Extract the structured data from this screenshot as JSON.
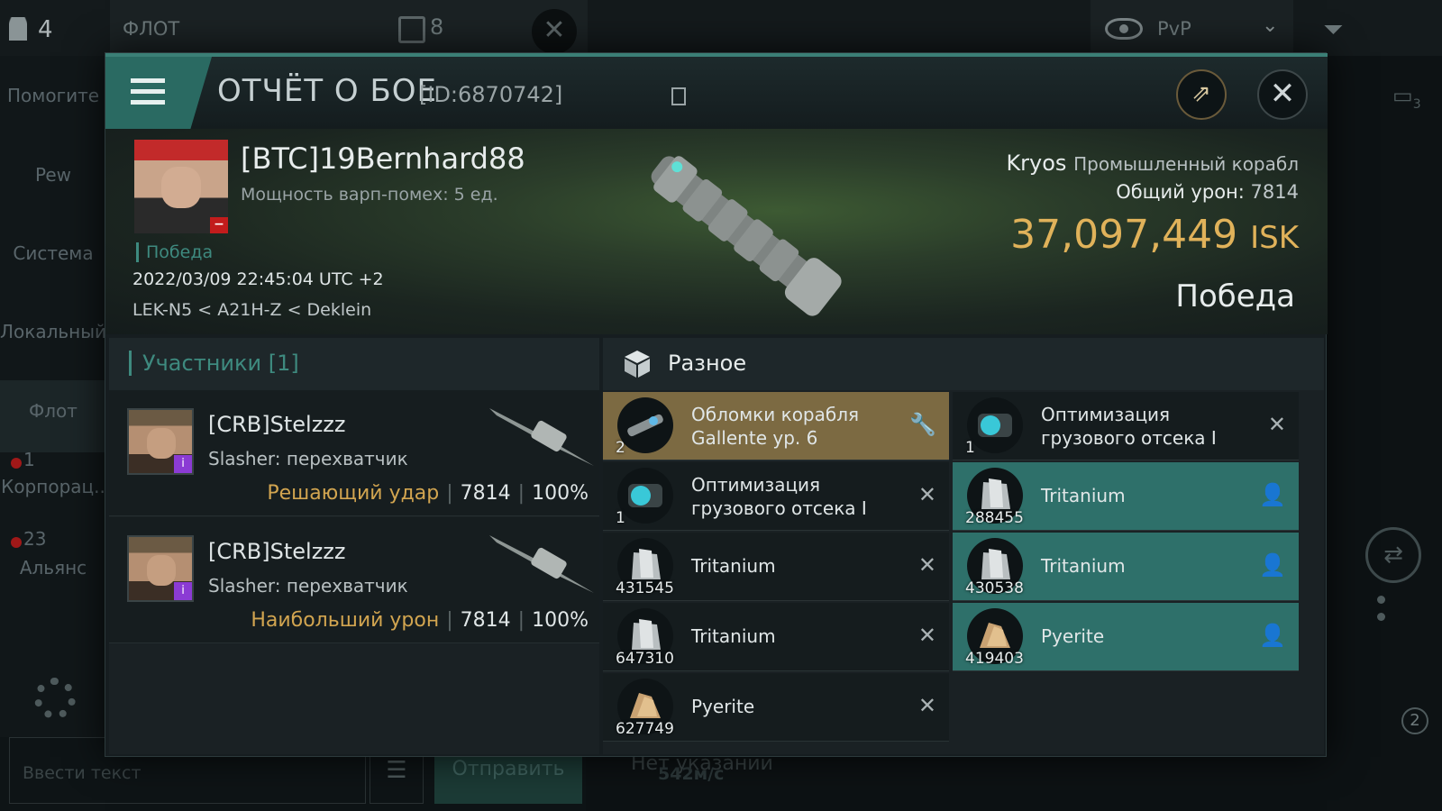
{
  "background": {
    "players_count": "4",
    "fleet_title": "ФЛОТ",
    "fleet_count": "8",
    "pvp_label": "PvP",
    "sidebar": [
      {
        "label": "Помогите"
      },
      {
        "label": "Pew"
      },
      {
        "label": "Система"
      },
      {
        "label": "Локальный"
      },
      {
        "label": "Флот"
      },
      {
        "label": "Корпорац.."
      },
      {
        "label": "Альянс"
      }
    ],
    "corp_badge": "1",
    "alliance_badge": "23",
    "chat_placeholder": "Ввести текст",
    "send_label": "Отправить",
    "bottom_hint": "Нет указаний",
    "speed": "542м/с",
    "right_badge": "2",
    "chat_count": "3"
  },
  "report": {
    "title": "ОТЧЁТ О БОЕ",
    "id": "[ID:6870742]",
    "pilot": "[BTC]19Bernhard88",
    "warp": "Мощность варп-помех: 5 ед.",
    "victory_tag": "Победа",
    "datetime": "2022/03/09 22:45:04 UTC +2",
    "location": "LEK-N5 < A21H-Z < Deklein",
    "ship_name": "Kryos",
    "ship_class": "Промышленный корабл",
    "damage_label": "Общий урон:",
    "damage_value": "7814",
    "isk_value": "37,097,449",
    "isk_unit": "ISK",
    "result": "Победа"
  },
  "participants": {
    "header": "Участники [1]",
    "rows": [
      {
        "name": "[CRB]Stelzzz",
        "ship": "Slasher: перехватчик",
        "role": "Решающий удар",
        "damage": "7814",
        "pct": "100%"
      },
      {
        "name": "[CRB]Stelzzz",
        "ship": "Slasher: перехватчик",
        "role": "Наибольший урон",
        "damage": "7814",
        "pct": "100%"
      }
    ]
  },
  "loot": {
    "header": "Разное",
    "items": [
      {
        "name": "Обломки корабля Gallente ур. 6",
        "qty": "2",
        "state": "highlight",
        "action": "wrench-icon"
      },
      {
        "name": "Оптимизация грузового отсека I",
        "qty": "1",
        "state": "dropped",
        "action": "close-icon"
      },
      {
        "name": "Оптимизация грузового отсека I",
        "qty": "1",
        "state": "dropped",
        "action": "close-icon"
      },
      {
        "name": "Tritanium",
        "qty": "288455",
        "state": "owned",
        "action": "person-icon"
      },
      {
        "name": "Tritanium",
        "qty": "431545",
        "state": "dropped",
        "action": "close-icon"
      },
      {
        "name": "Tritanium",
        "qty": "430538",
        "state": "owned",
        "action": "person-icon"
      },
      {
        "name": "Tritanium",
        "qty": "647310",
        "state": "dropped",
        "action": "close-icon"
      },
      {
        "name": "Pyerite",
        "qty": "419403",
        "state": "owned",
        "action": "person-icon"
      },
      {
        "name": "Pyerite",
        "qty": "627749",
        "state": "dropped",
        "action": "close-icon"
      }
    ]
  },
  "colors": {
    "accent": "#2e706a",
    "gold": "#e0b25a",
    "highlight": "#7c6a42"
  }
}
